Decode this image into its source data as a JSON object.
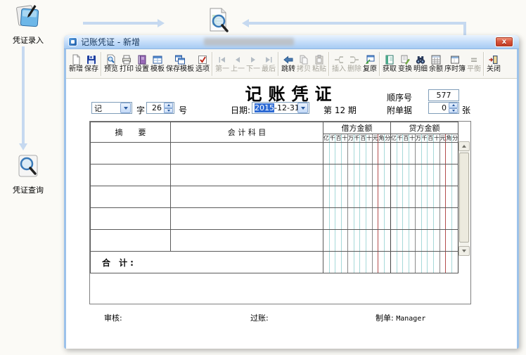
{
  "desktop": {
    "entry_icon_label": "凭证录入",
    "query_icon_label": "凭证查询"
  },
  "window": {
    "title": "记账凭证 - 新增",
    "close_glyph": "x"
  },
  "toolbar": {
    "new": "新增",
    "save": "保存",
    "preview": "预览",
    "print": "打印",
    "settings": "设置",
    "template": "模板",
    "save_template": "保存模板",
    "options": "选项",
    "first": "第一",
    "prev": "上一",
    "next": "下一",
    "last": "最后",
    "jump": "跳转",
    "copy": "拷贝",
    "paste": "粘贴",
    "insert": "插入",
    "delete": "删除",
    "restore": "复原",
    "fetch": "获取",
    "transform": "变换",
    "detail": "明细",
    "balance": "余额",
    "journal": "序时簿",
    "equilibrium": "平衡",
    "close": "关闭"
  },
  "voucher": {
    "form_title": "记账凭证",
    "seq_label": "顺序号",
    "seq_value": "577",
    "type_value": "记",
    "zi_label": "字",
    "number_value": "26",
    "hao_label": "号",
    "date_label": "日期:",
    "date_selected": "2015",
    "date_rest": "-12-31",
    "period_text": "第 12 期",
    "attach_label": "附单据",
    "attach_value": "0",
    "attach_unit": "张",
    "grid": {
      "summary_header": "摘　　要",
      "account_header": "会  计  科  目",
      "debit_header": "借方金额",
      "credit_header": "贷方金额",
      "digit_labels": [
        "亿",
        "千",
        "百",
        "十",
        "万",
        "千",
        "百",
        "十",
        "元",
        "角",
        "分"
      ],
      "body_row_count": 5,
      "total_label": "合  计:"
    },
    "footer": {
      "audit_label": "审核:",
      "post_label": "过账:",
      "maker_label": "制单:",
      "maker_value": "Manager"
    }
  }
}
